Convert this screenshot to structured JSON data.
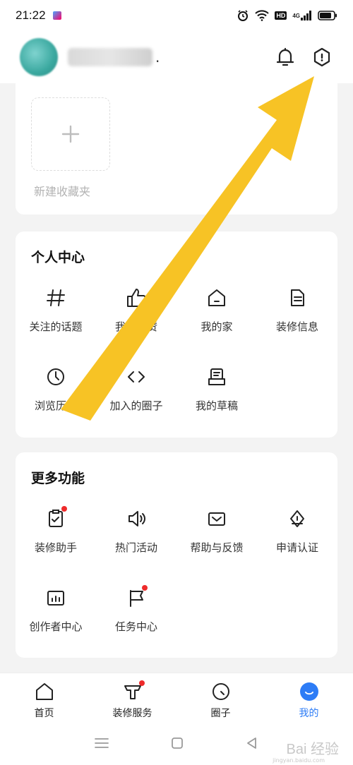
{
  "status_bar": {
    "time": "21:22",
    "icons": [
      "alarm-icon",
      "wifi-icon",
      "hd-icon",
      "signal-icon",
      "battery-icon"
    ],
    "hd_label": "HD",
    "signal_label": "4G"
  },
  "header": {
    "icons": [
      "bell-icon",
      "settings-hex-icon"
    ]
  },
  "favorites": {
    "new_folder_label": "新建收藏夹"
  },
  "personal_center": {
    "title": "个人中心",
    "items": [
      {
        "label": "关注的话题",
        "icon": "hashtag-icon"
      },
      {
        "label": "我的点赞",
        "icon": "thumbs-up-icon"
      },
      {
        "label": "我的家",
        "icon": "home-icon"
      },
      {
        "label": "装修信息",
        "icon": "document-icon"
      },
      {
        "label": "浏览历史",
        "icon": "clock-icon"
      },
      {
        "label": "加入的圈子",
        "icon": "code-brackets-icon"
      },
      {
        "label": "我的草稿",
        "icon": "draft-icon"
      }
    ]
  },
  "more_features": {
    "title": "更多功能",
    "items": [
      {
        "label": "装修助手",
        "icon": "clipboard-check-icon",
        "badge": true
      },
      {
        "label": "热门活动",
        "icon": "speaker-icon",
        "badge": false
      },
      {
        "label": "帮助与反馈",
        "icon": "mail-icon",
        "badge": false
      },
      {
        "label": "申请认证",
        "icon": "pen-nib-icon",
        "badge": false
      },
      {
        "label": "创作者中心",
        "icon": "bar-chart-icon",
        "badge": false
      },
      {
        "label": "任务中心",
        "icon": "flag-icon",
        "badge": true
      }
    ]
  },
  "bottom_nav": {
    "items": [
      {
        "label": "首页",
        "icon": "home-icon",
        "active": false
      },
      {
        "label": "装修服务",
        "icon": "service-icon",
        "active": false,
        "badge": true
      },
      {
        "label": "圈子",
        "icon": "circle-icon",
        "active": false
      },
      {
        "label": "我的",
        "icon": "profile-smile-icon",
        "active": true
      }
    ],
    "active_color": "#2d7cf6"
  },
  "system_nav": {
    "icons": [
      "menu-icon",
      "home-square-icon",
      "back-icon"
    ]
  },
  "watermark": {
    "text": "Bai 经验",
    "sub": "jingyan.baidu.com"
  },
  "colors": {
    "accent": "#2d7cf6",
    "badge": "#ee2b2b",
    "arrow": "#f7c325"
  }
}
